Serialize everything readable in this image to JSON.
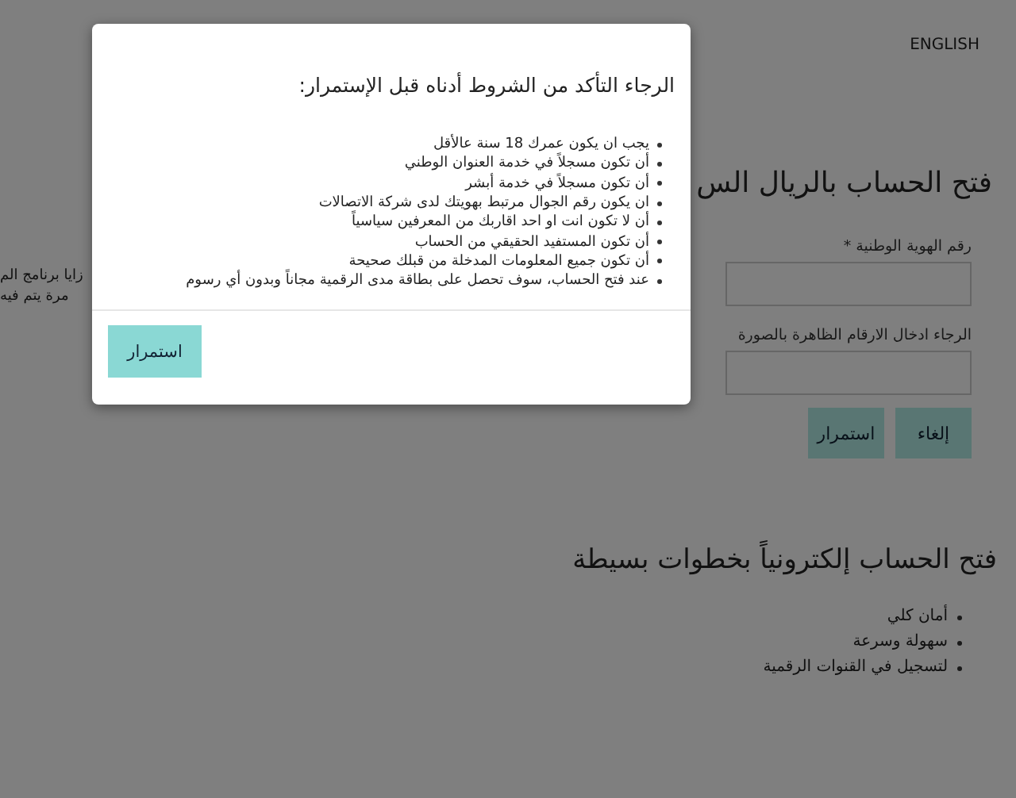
{
  "header": {
    "language_link": "ENGLISH"
  },
  "account_form": {
    "title": "فتح الحساب بالريال الس",
    "intro_fragments": [
      "زايا برنامج الم",
      "مرة يتم فيه"
    ],
    "fields": [
      {
        "label": "رقم الهوية الوطنية *"
      },
      {
        "label": "الرجاء ادخال الارقام الظاهرة بالصورة"
      }
    ],
    "buttons": [
      "إلغاء",
      "استمرار"
    ]
  },
  "steps_section": {
    "title": "فتح الحساب إلكترونياً بخطوات بسيطة",
    "items": [
      "أمان كلي",
      "سهولة وسرعة",
      "لتسجيل في القنوات الرقمية"
    ]
  },
  "modal": {
    "title": "الرجاء التأكد من الشروط أدناه قبل الإستمرار:",
    "conditions": [
      "يجب ان يكون عمرك 18 سنة عالأقل",
      "أن تكون مسجلاً في خدمة العنوان الوطني",
      "أن تكون مسجلاً في خدمة أبشر",
      "ان يكون رقم الجوال مرتبط بهويتك لدى شركة الاتصالات",
      "أن لا تكون انت او احد اقاربك من المعرفين سياسياً",
      "أن تكون المستفيد الحقيقي من الحساب",
      "أن تكون جميع المعلومات المدخلة من قبلك صحيحة",
      "عند فتح الحساب، سوف تحصل على بطاقة مدى الرقمية مجاناً وبدون أي رسوم"
    ],
    "button": "استمرار"
  }
}
